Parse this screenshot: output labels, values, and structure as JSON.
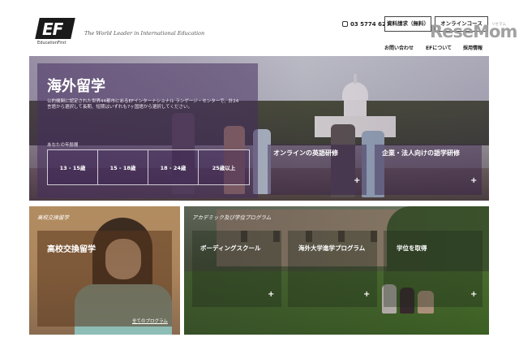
{
  "header": {
    "logo_text": "EF",
    "logo_sub": "EducationFirst",
    "tagline": "The World Leader in International Education",
    "phone": "03 5774 6210",
    "brochure_button": "資料請求（無料）",
    "online_button": "オンラインコース",
    "watermark": "ReseMom",
    "watermark_small": "リセマム",
    "nav": [
      "お問い合わせ",
      "EFについて",
      "採用情報"
    ]
  },
  "hero": {
    "title": "海外留学",
    "description": "公的機関に認定された世界44都市にあるEFインターナショナル ランゲージ・センターで、計24言語から選択して長期、短期はいずれも7ヶ国語から選択してください。",
    "age_label": "あなたの年齢層",
    "age_options": [
      "13 - 15歳",
      "15 - 18歳",
      "18 - 24歳",
      "25歳以上"
    ],
    "cards": [
      {
        "title": "オンラインの英語研修"
      },
      {
        "title": "企業・法人向けの語学研修"
      }
    ]
  },
  "exchange": {
    "category": "高校交換留学",
    "title": "高校交換留学",
    "link": "全てのプログラム"
  },
  "academic": {
    "category": "アカデミック及び学位プログラム",
    "programs": [
      {
        "title": "ボーディングスクール"
      },
      {
        "title": "海外大学進学プログラム"
      },
      {
        "title": "学位を取得"
      }
    ]
  },
  "icons": {
    "plus": "+",
    "phone": "phone-icon"
  }
}
